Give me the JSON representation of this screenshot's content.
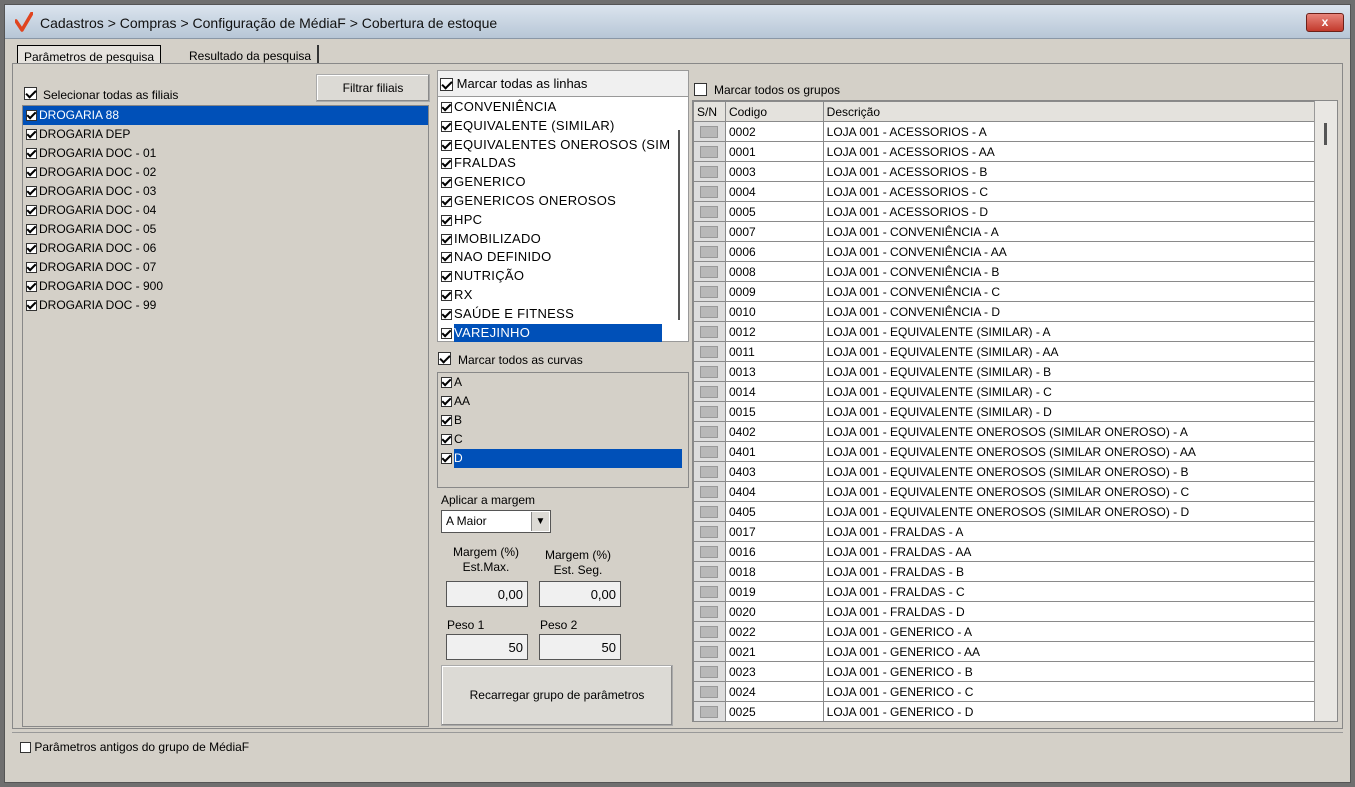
{
  "window": {
    "title": "Cadastros > Compras > Configuração de MédiaF > Cobertura de estoque",
    "close_label": "x"
  },
  "tabs": [
    {
      "label": "Parâmetros de pesquisa",
      "active": true
    },
    {
      "label": "Resultado da pesquisa",
      "active": false
    }
  ],
  "filiais": {
    "select_all_label": "Selecionar todas as filiais",
    "select_all_checked": true,
    "filter_button": "Filtrar filiais",
    "items": [
      {
        "label": "DROGARIA 88",
        "checked": true,
        "selected": true
      },
      {
        "label": "DROGARIA DEP",
        "checked": true
      },
      {
        "label": "DROGARIA DOC - 01",
        "checked": true
      },
      {
        "label": "DROGARIA DOC - 02",
        "checked": true
      },
      {
        "label": "DROGARIA DOC - 03",
        "checked": true
      },
      {
        "label": "DROGARIA DOC - 04",
        "checked": true
      },
      {
        "label": "DROGARIA DOC - 05",
        "checked": true
      },
      {
        "label": "DROGARIA DOC - 06",
        "checked": true
      },
      {
        "label": "DROGARIA DOC - 07",
        "checked": true
      },
      {
        "label": "DROGARIA DOC - 900",
        "checked": true
      },
      {
        "label": "DROGARIA DOC - 99",
        "checked": true
      }
    ]
  },
  "linhas": {
    "select_all_label": "Marcar todas as linhas",
    "select_all_checked": true,
    "items": [
      {
        "label": "CONVENIÊNCIA",
        "checked": true
      },
      {
        "label": "EQUIVALENTE (SIMILAR)",
        "checked": true
      },
      {
        "label": "EQUIVALENTES ONEROSOS (SIM",
        "checked": true
      },
      {
        "label": "FRALDAS",
        "checked": true
      },
      {
        "label": "GENERICO",
        "checked": true
      },
      {
        "label": "GENERICOS ONEROSOS",
        "checked": true
      },
      {
        "label": "HPC",
        "checked": true
      },
      {
        "label": "IMOBILIZADO",
        "checked": true
      },
      {
        "label": "NAO DEFINIDO",
        "checked": true
      },
      {
        "label": "NUTRIÇÃO",
        "checked": true
      },
      {
        "label": "RX",
        "checked": true
      },
      {
        "label": "SAÚDE E FITNESS",
        "checked": true
      },
      {
        "label": "VAREJINHO",
        "checked": true,
        "selected": true
      }
    ]
  },
  "curvas": {
    "select_all_label": "Marcar todos as curvas",
    "select_all_checked": true,
    "items": [
      {
        "label": "A",
        "checked": true
      },
      {
        "label": "AA",
        "checked": true
      },
      {
        "label": "B",
        "checked": true
      },
      {
        "label": "C",
        "checked": true
      },
      {
        "label": "D",
        "checked": true,
        "selected": true
      }
    ]
  },
  "margem": {
    "apply_label": "Aplicar a margem",
    "apply_value": "A Maior",
    "max_label_1": "Margem (%)",
    "max_label_2": "Est.Max.",
    "max_value": "0,00",
    "seg_label_1": "Margem (%)",
    "seg_label_2": "Est. Seg.",
    "seg_value": "0,00",
    "peso1_label": "Peso 1",
    "peso1_value": "50",
    "peso2_label": "Peso 2",
    "peso2_value": "50",
    "reload_button": "Recarregar grupo de parâmetros"
  },
  "grupos": {
    "select_all_label": "Marcar todos os grupos",
    "select_all_checked": false,
    "columns": [
      "S/N",
      "Codigo",
      "Descrição"
    ],
    "rows": [
      {
        "code": "0002",
        "desc": "LOJA 001 - ACESSORIOS - A"
      },
      {
        "code": "0001",
        "desc": "LOJA 001 - ACESSORIOS - AA"
      },
      {
        "code": "0003",
        "desc": "LOJA 001 - ACESSORIOS - B"
      },
      {
        "code": "0004",
        "desc": "LOJA 001 - ACESSORIOS - C"
      },
      {
        "code": "0005",
        "desc": "LOJA 001 - ACESSORIOS - D"
      },
      {
        "code": "0007",
        "desc": "LOJA 001 - CONVENIÊNCIA - A"
      },
      {
        "code": "0006",
        "desc": "LOJA 001 - CONVENIÊNCIA - AA"
      },
      {
        "code": "0008",
        "desc": "LOJA 001 - CONVENIÊNCIA - B"
      },
      {
        "code": "0009",
        "desc": "LOJA 001 - CONVENIÊNCIA - C"
      },
      {
        "code": "0010",
        "desc": "LOJA 001 - CONVENIÊNCIA - D"
      },
      {
        "code": "0012",
        "desc": "LOJA 001 - EQUIVALENTE (SIMILAR) - A"
      },
      {
        "code": "0011",
        "desc": "LOJA 001 - EQUIVALENTE (SIMILAR) - AA"
      },
      {
        "code": "0013",
        "desc": "LOJA 001 - EQUIVALENTE (SIMILAR) - B"
      },
      {
        "code": "0014",
        "desc": "LOJA 001 - EQUIVALENTE (SIMILAR) - C"
      },
      {
        "code": "0015",
        "desc": "LOJA 001 - EQUIVALENTE (SIMILAR) - D"
      },
      {
        "code": "0402",
        "desc": "LOJA 001 - EQUIVALENTE ONEROSOS (SIMILAR ONEROSO) - A"
      },
      {
        "code": "0401",
        "desc": "LOJA 001 - EQUIVALENTE ONEROSOS (SIMILAR ONEROSO) - AA"
      },
      {
        "code": "0403",
        "desc": "LOJA 001 - EQUIVALENTE ONEROSOS (SIMILAR ONEROSO) - B"
      },
      {
        "code": "0404",
        "desc": "LOJA 001 - EQUIVALENTE ONEROSOS (SIMILAR ONEROSO) - C"
      },
      {
        "code": "0405",
        "desc": "LOJA 001 - EQUIVALENTE ONEROSOS (SIMILAR ONEROSO) - D"
      },
      {
        "code": "0017",
        "desc": "LOJA 001 - FRALDAS - A"
      },
      {
        "code": "0016",
        "desc": "LOJA 001 - FRALDAS - AA"
      },
      {
        "code": "0018",
        "desc": "LOJA 001 - FRALDAS - B"
      },
      {
        "code": "0019",
        "desc": "LOJA 001 - FRALDAS - C"
      },
      {
        "code": "0020",
        "desc": "LOJA 001 - FRALDAS - D"
      },
      {
        "code": "0022",
        "desc": "LOJA 001 - GENERICO - A"
      },
      {
        "code": "0021",
        "desc": "LOJA 001 - GENERICO - AA"
      },
      {
        "code": "0023",
        "desc": "LOJA 001 - GENERICO - B"
      },
      {
        "code": "0024",
        "desc": "LOJA 001 - GENERICO - C"
      },
      {
        "code": "0025",
        "desc": "LOJA 001 - GENERICO - D"
      }
    ]
  },
  "footer": {
    "old_params_label": "Parâmetros antigos do grupo de MédiaF",
    "old_params_checked": false
  },
  "colors": {
    "selection": "#0050b8",
    "logo": "#e0441f",
    "close": "#c23a2c"
  },
  "icons": {
    "logo": "check-logo-icon",
    "dropdown": "chevron-down-icon"
  }
}
